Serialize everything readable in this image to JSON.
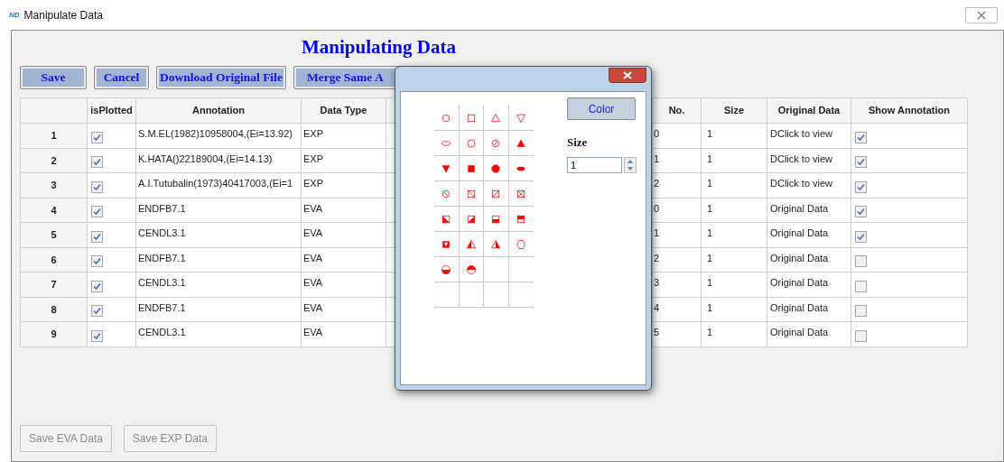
{
  "window": {
    "logo": "ND",
    "title": "Manipulate Data"
  },
  "heading": "Manipulating Data",
  "toolbar": [
    "Save",
    "Cancel",
    "Download Original File",
    "Merge Same A"
  ],
  "table": {
    "columns": [
      "isPlotted",
      "Annotation",
      "Data Type",
      "No.",
      "Size",
      "Original Data",
      "Show Annotation"
    ],
    "rows": [
      {
        "index": "1",
        "is_plotted": true,
        "annotation": "S.M.EL(1982)10958004,(Ei=13.92)",
        "data_type": "EXP",
        "no": "0",
        "size": "1",
        "original_data": "DClick to view",
        "show_annotation": true
      },
      {
        "index": "2",
        "is_plotted": true,
        "annotation": "K.HATA()22189004,(Ei=14.13)",
        "data_type": "EXP",
        "no": "1",
        "size": "1",
        "original_data": "DClick to view",
        "show_annotation": true
      },
      {
        "index": "3",
        "is_plotted": true,
        "annotation": "A.I.Tutubalin(1973)40417003,(Ei=1",
        "data_type": "EXP",
        "no": "2",
        "size": "1",
        "original_data": "DClick to view",
        "show_annotation": true
      },
      {
        "index": "4",
        "is_plotted": true,
        "annotation": "ENDFB7.1",
        "data_type": "EVA",
        "no": "0",
        "size": "1",
        "original_data": "Original Data",
        "show_annotation": true
      },
      {
        "index": "5",
        "is_plotted": true,
        "annotation": "CENDL3.1",
        "data_type": "EVA",
        "no": "1",
        "size": "1",
        "original_data": "Original Data",
        "show_annotation": true
      },
      {
        "index": "6",
        "is_plotted": true,
        "annotation": "ENDFB7.1",
        "data_type": "EVA",
        "no": "2",
        "size": "1",
        "original_data": "Original Data",
        "show_annotation": false
      },
      {
        "index": "7",
        "is_plotted": true,
        "annotation": "CENDL3.1",
        "data_type": "EVA",
        "no": "3",
        "size": "1",
        "original_data": "Original Data",
        "show_annotation": false
      },
      {
        "index": "8",
        "is_plotted": true,
        "annotation": "ENDFB7.1",
        "data_type": "EVA",
        "no": "4",
        "size": "1",
        "original_data": "Original Data",
        "show_annotation": false
      },
      {
        "index": "9",
        "is_plotted": true,
        "annotation": "CENDL3.1",
        "data_type": "EVA",
        "no": "5",
        "size": "1",
        "original_data": "Original Data",
        "show_annotation": false
      }
    ]
  },
  "bottom_buttons": [
    {
      "label": "Save EVA Data",
      "disabled": true
    },
    {
      "label": "Save EXP Data",
      "disabled": true
    }
  ],
  "marker_dialog": {
    "color_button": "Color",
    "size_label": "Size",
    "size_value": "1"
  }
}
